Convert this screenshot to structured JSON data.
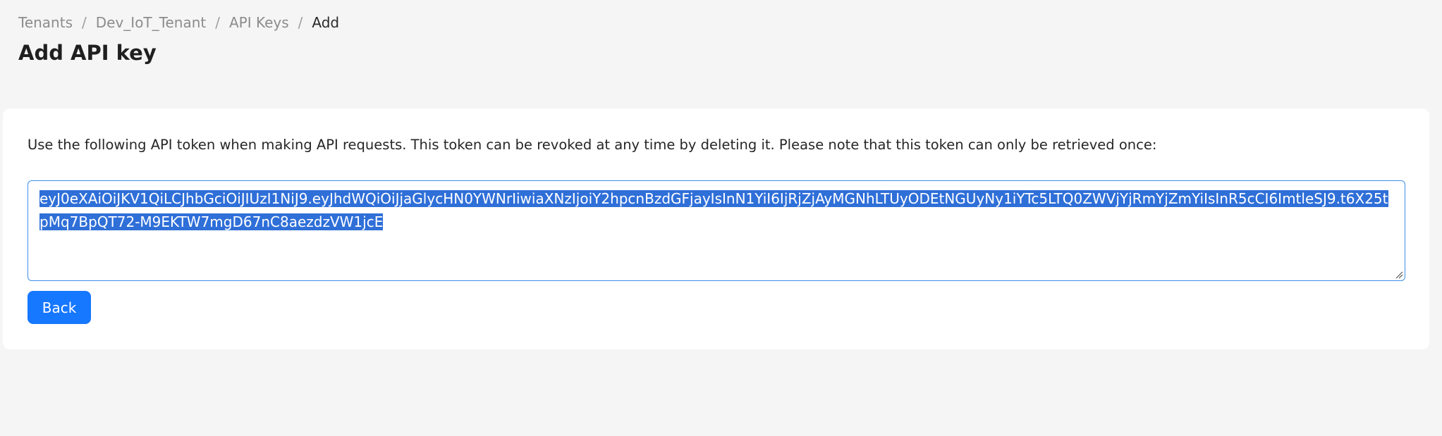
{
  "breadcrumb": {
    "items": [
      "Tenants",
      "Dev_IoT_Tenant",
      "API Keys"
    ],
    "separator": "/",
    "current": "Add"
  },
  "page": {
    "title": "Add API key"
  },
  "card": {
    "message": "Use the following API token when making API requests. This token can be revoked at any time by deleting it. Please note that this token can only be retrieved once:",
    "token": "eyJ0eXAiOiJKV1QiLCJhbGciOiJIUzI1NiJ9.eyJhdWQiOiJjaGlycHN0YWNrIiwiaXNzIjoiY2hpcnBzdGFjayIsInN1YiI6IjRjZjAyMGNhLTUyODEtNGUyNy1iYTc5LTQ0ZWVjYjRmYjZmYiIsInR5cCI6ImtleSJ9.t6X25tpMq7BpQT72-M9EKTW7mgD67nC8aezdzVW1jcE",
    "token_selected": true,
    "back_label": "Back"
  },
  "colors": {
    "accent": "#1677ff",
    "selection": "#2f6fd8",
    "focus_border": "#3d8fe8"
  }
}
